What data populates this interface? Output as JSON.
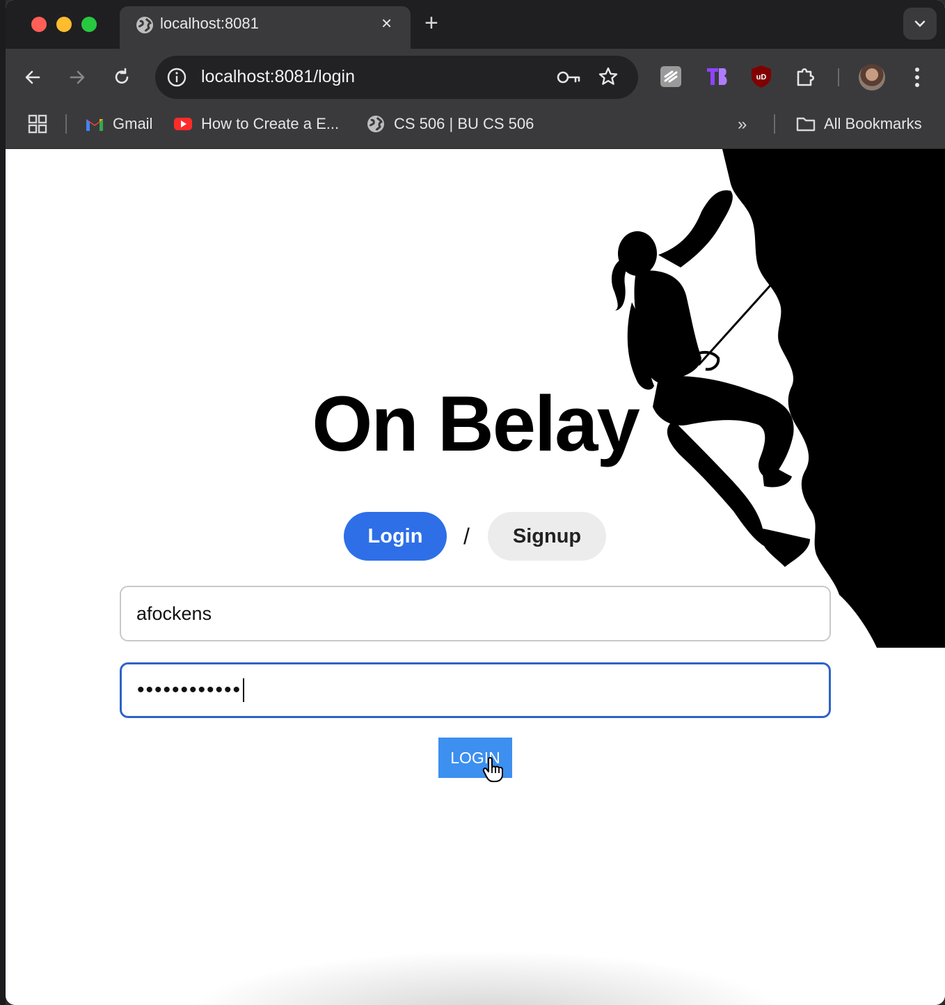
{
  "browser": {
    "tab_title": "localhost:8081",
    "url": "localhost:8081/login",
    "bookmarks": [
      {
        "label": "Gmail"
      },
      {
        "label": "How to Create a E..."
      },
      {
        "label": "CS 506 | BU CS 506"
      }
    ],
    "all_bookmarks_label": "All Bookmarks",
    "icons": {
      "close": "×",
      "new_tab": "+",
      "more_bookmarks": "»"
    }
  },
  "app": {
    "title": "On Belay",
    "mode_login": "Login",
    "mode_separator": "/",
    "mode_signup": "Signup",
    "username_value": "afockens",
    "password_masked": "••••••••••••",
    "submit_label": "LOGIN"
  },
  "colors": {
    "accent": "#2e6fe8",
    "submit": "#3d8ff0",
    "focus_border": "#2d63c8"
  }
}
